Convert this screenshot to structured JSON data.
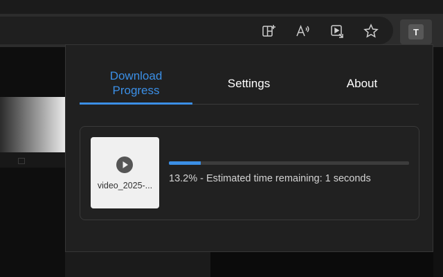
{
  "browser": {
    "toolbar_icons": [
      "split-screen-icon",
      "read-aloud-icon",
      "media-cast-icon",
      "favorite-star-icon"
    ],
    "profile_initial": "T"
  },
  "popup": {
    "tabs": [
      {
        "label": "Download Progress",
        "active": true
      },
      {
        "label": "Settings",
        "active": false
      },
      {
        "label": "About",
        "active": false
      }
    ],
    "download": {
      "thumbnail_icon": "play-circle-icon",
      "file_name": "video_2025-...",
      "progress_fraction": 0.132,
      "status_text": "13.2% - Estimated time remaining: 1 seconds"
    }
  },
  "colors": {
    "accent": "#3b8fe6",
    "popup_bg": "#202020",
    "text": "#d4d4d4"
  }
}
